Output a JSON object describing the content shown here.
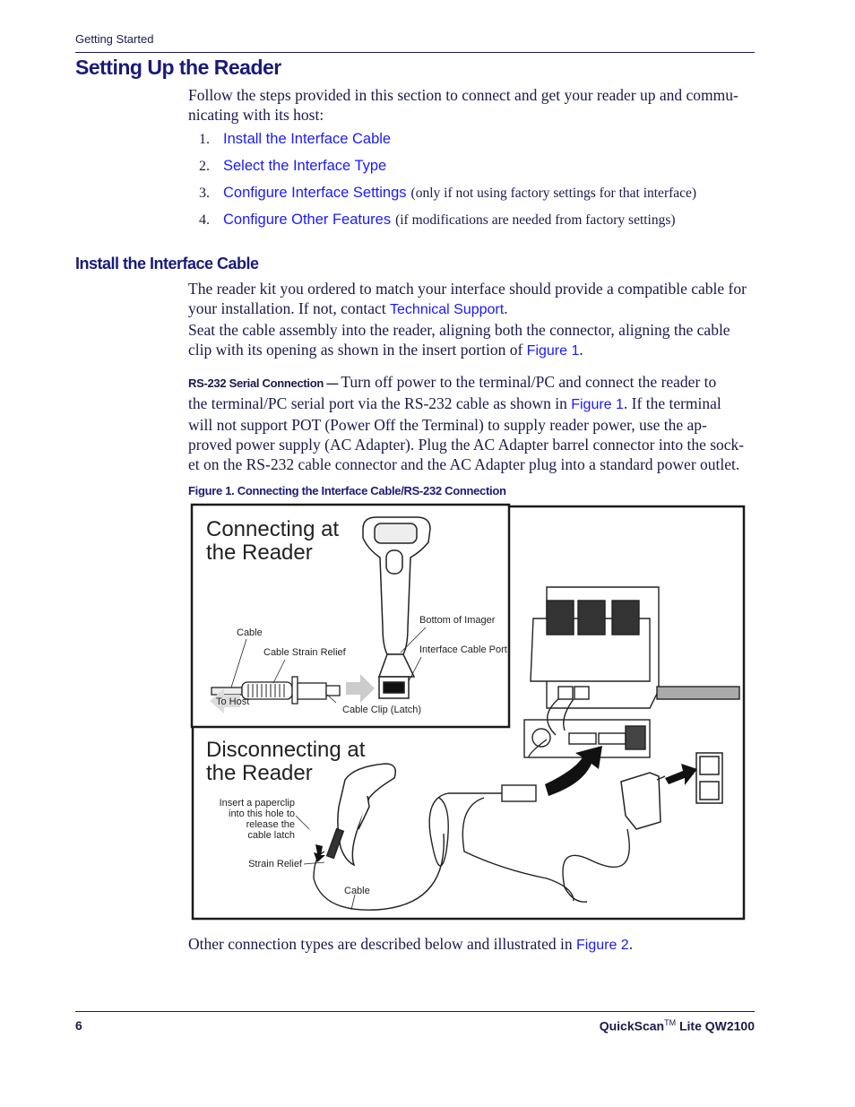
{
  "header": {
    "running_head": "Getting Started"
  },
  "section": {
    "title": "Setting Up the Reader",
    "intro": "Follow the steps provided in this section to connect and get your reader up and commu-nicating with its host:",
    "intro_line1": "Follow the steps provided in this section to connect and get your reader up and commu-",
    "intro_line2": "nicating with its host:",
    "steps": [
      {
        "num": "1.",
        "link": "Install the Interface Cable",
        "note": ""
      },
      {
        "num": "2.",
        "link": "Select the Interface Type",
        "note": ""
      },
      {
        "num": "3.",
        "link": "Configure Interface Settings",
        "note": "(only if not using factory settings for that interface)"
      },
      {
        "num": "4.",
        "link": "Configure Other Features",
        "note": "(if modifications are needed from factory settings)"
      }
    ]
  },
  "subsection": {
    "title": "Install the Interface Cable",
    "p1_line1": "The reader kit you ordered to match your interface should provide a compatible cable for",
    "p1_line2_pre": "your installation. If not, contact ",
    "p1_link": "Technical Support",
    "p1_line2_post": ".",
    "p2_line1": "Seat the cable assembly into the reader, aligning both the connector, aligning the cable",
    "p2_line2_pre": "clip with its opening as shown in the insert portion of ",
    "p2_link": "Figure 1",
    "p2_line2_post": ".",
    "rs232_label": "RS-232 Serial Connection",
    "rs232_dash": " — ",
    "rs232_line1": "Turn off power to the terminal/PC and connect the reader to",
    "rs232_line2_pre": "the terminal/PC serial port via the RS-232 cable as shown in ",
    "rs232_link": "Figure 1",
    "rs232_line2_post": ". If the terminal",
    "rs232_line3": "will not support POT (Power Off the Terminal) to supply reader power, use the ap-",
    "rs232_line4": "proved power supply (AC Adapter). Plug the AC Adapter barrel connector into the sock-",
    "rs232_line5": "et on the RS-232 cable connector and the AC Adapter plug into a standard power outlet."
  },
  "figure": {
    "caption": "Figure 1. Connecting the Interface Cable/RS-232 Connection",
    "connect_title_1": "Connecting at",
    "connect_title_2": "the Reader",
    "disconnect_title_1": "Disconnecting at",
    "disconnect_title_2": "the Reader",
    "labels": {
      "cable": "Cable",
      "cable_strain_relief": "Cable Strain Relief",
      "to_host": "To Host",
      "cable_clip": "Cable Clip (Latch)",
      "bottom_of_imager": "Bottom of Imager",
      "interface_cable_port": "Interface Cable Port",
      "paperclip_1": "Insert a paperclip",
      "paperclip_2": "into this hole to",
      "paperclip_3": "release the",
      "paperclip_4": "cable latch",
      "strain_relief": "Strain Relief",
      "cable_bottom": "Cable"
    }
  },
  "closing": {
    "pre": "Other connection types are described below and illustrated in ",
    "link": "Figure 2",
    "post": "."
  },
  "footer": {
    "page_number": "6",
    "product": "QuickScan",
    "tm": "TM",
    "product_suffix": " Lite QW2100"
  },
  "colors": {
    "link": "#1a1aff",
    "heading": "#1a1a7a",
    "text": "#1a1a4a"
  }
}
